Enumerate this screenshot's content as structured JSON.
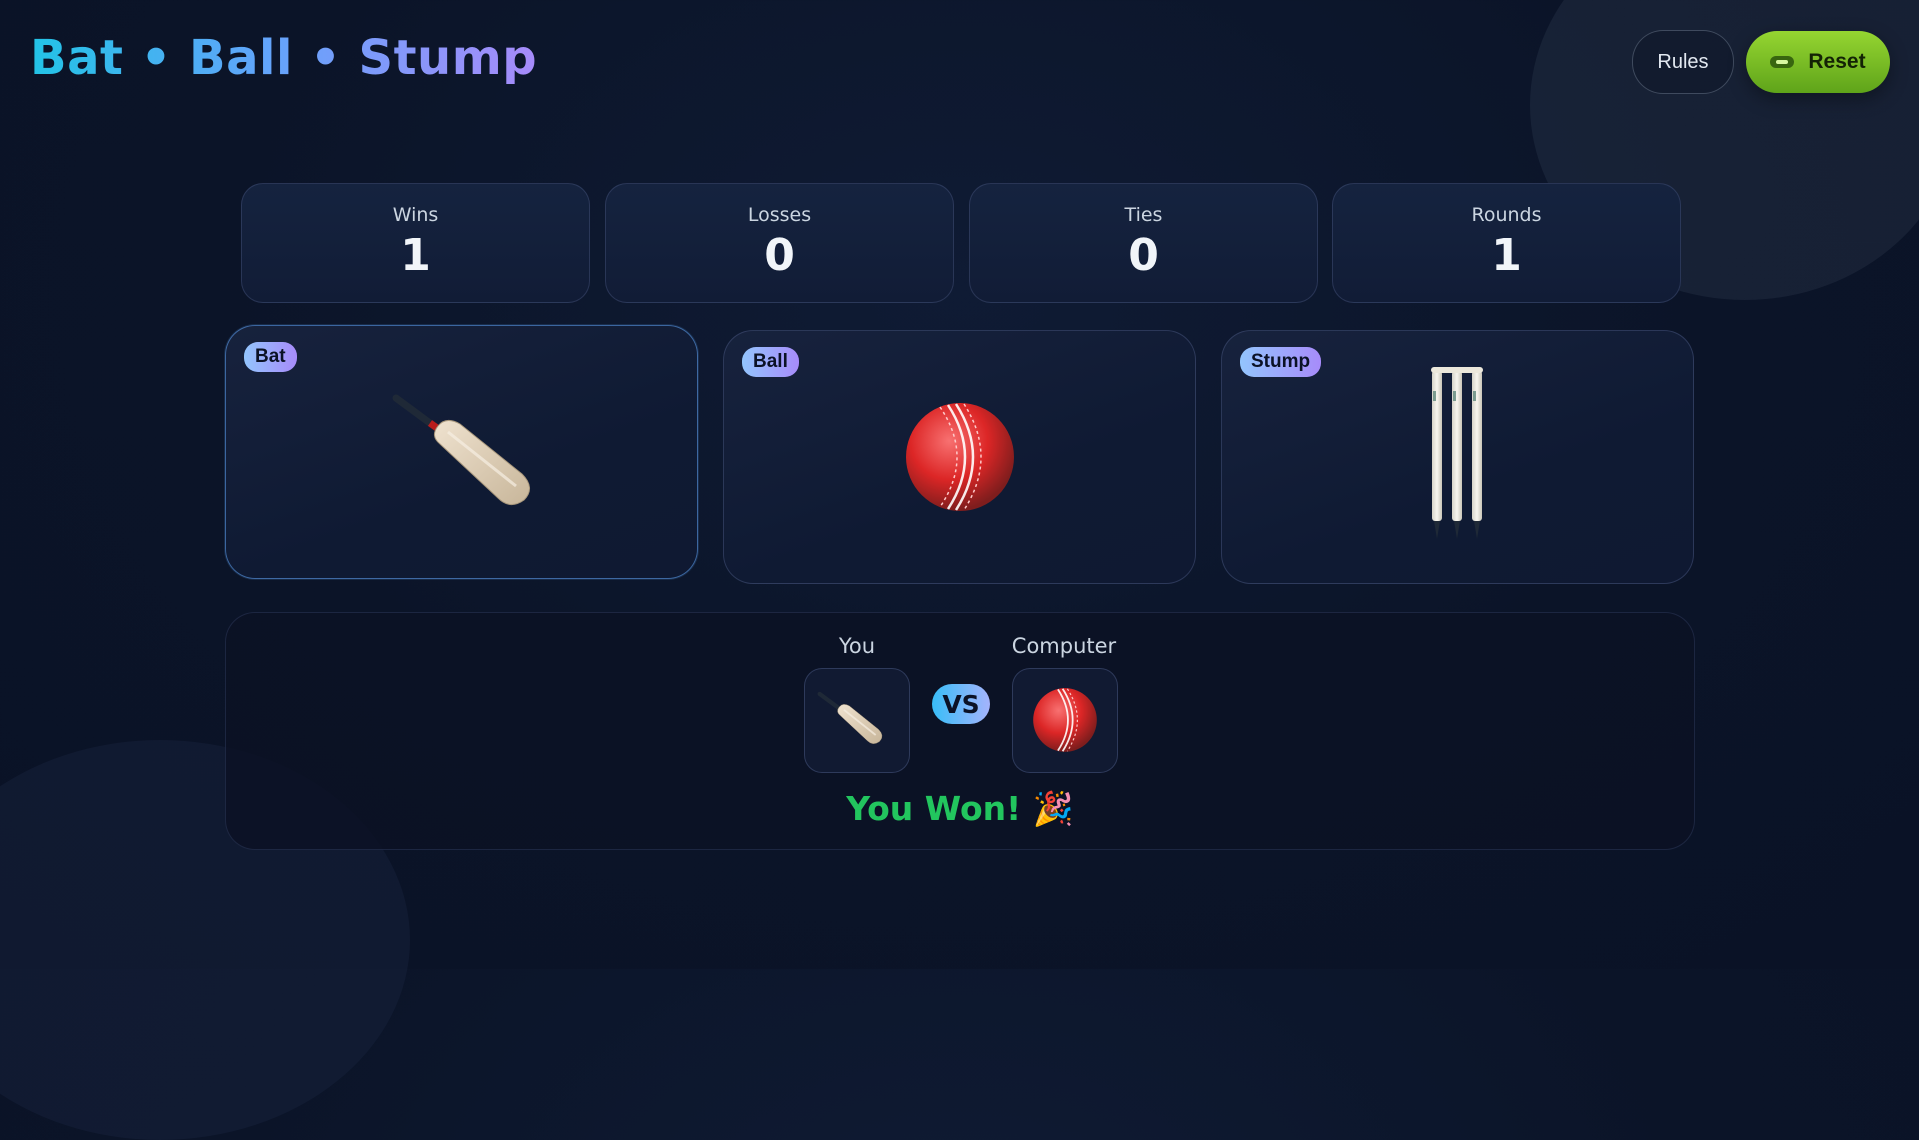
{
  "header": {
    "title": "Bat • Ball • Stump",
    "rules_label": "Rules",
    "reset_label": "Reset"
  },
  "stats": [
    {
      "label": "Wins",
      "value": "1"
    },
    {
      "label": "Losses",
      "value": "0"
    },
    {
      "label": "Ties",
      "value": "0"
    },
    {
      "label": "Rounds",
      "value": "1"
    }
  ],
  "choices": [
    {
      "label": "Bat",
      "icon": "cricket-bat-icon",
      "selected": true
    },
    {
      "label": "Ball",
      "icon": "cricket-ball-icon",
      "selected": false
    },
    {
      "label": "Stump",
      "icon": "stumps-icon",
      "selected": false
    }
  ],
  "result": {
    "you_label": "You",
    "computer_label": "Computer",
    "vs_label": "VS",
    "you_choice": "cricket-bat-icon",
    "computer_choice": "cricket-ball-icon",
    "outcome": "You Won! 🎉"
  },
  "colors": {
    "win": "#22c55e",
    "reset_button": "#7fc423",
    "title_gradient": [
      "#22c3e6",
      "#a78bfa"
    ]
  }
}
